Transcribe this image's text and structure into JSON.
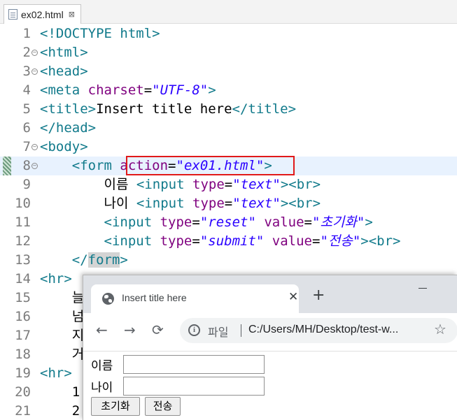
{
  "editor": {
    "tab_label": "ex02.html",
    "tab_close": "⊠",
    "lines": [
      {
        "n": "1"
      },
      {
        "n": "2"
      },
      {
        "n": "3"
      },
      {
        "n": "4"
      },
      {
        "n": "5"
      },
      {
        "n": "6"
      },
      {
        "n": "7"
      },
      {
        "n": "8"
      },
      {
        "n": "9"
      },
      {
        "n": "10"
      },
      {
        "n": "11"
      },
      {
        "n": "12"
      },
      {
        "n": "13"
      },
      {
        "n": "14"
      },
      {
        "n": "15"
      },
      {
        "n": "16"
      },
      {
        "n": "17"
      },
      {
        "n": "18"
      },
      {
        "n": "19"
      },
      {
        "n": "20"
      },
      {
        "n": "21"
      }
    ],
    "code": {
      "l1": "<!DOCTYPE html>",
      "l2": "<html>",
      "l3": "<head>",
      "l4_tag": "<meta ",
      "l4_attr": "charset",
      "l4_val": "\"UTF-8\"",
      "l4_end": ">",
      "l5_open": "<title>",
      "l5_text": "Insert title here",
      "l5_close": "</title>",
      "l6": "</head>",
      "l7": "<body>",
      "l8_tag": "<form ",
      "l8_attr": "action",
      "l8_val": "\"ex01.html\"",
      "l8_end": ">",
      "l9_text": "이름 ",
      "l9_tag": "<input ",
      "l9_attr": "type",
      "l9_val": "\"text\"",
      "l9_end": "><br>",
      "l10_text": "나이 ",
      "l10_tag": "<input ",
      "l10_attr": "type",
      "l10_val": "\"text\"",
      "l10_end": "><br>",
      "l11_tag": "<input ",
      "l11_attr1": "type",
      "l11_val1": "\"reset\"",
      "l11_attr2": "value",
      "l11_val2": "\"초기화\"",
      "l11_end": ">",
      "l12_tag": "<input ",
      "l12_attr1": "type",
      "l12_val1": "\"submit\"",
      "l12_attr2": "value",
      "l12_val2": "\"전송\"",
      "l12_end": "><br>",
      "l13_open": "</",
      "l13_name": "form",
      "l13_end": ">",
      "l14": "<hr>",
      "l15": "늘",
      "l16": "넘",
      "l17": "지",
      "l18": "거",
      "l19": "<hr>",
      "l20": "1",
      "l21": "2"
    }
  },
  "browser": {
    "tab_title": "Insert title here",
    "tab_close": "✕",
    "new_tab": "+",
    "back": "←",
    "forward": "→",
    "reload": "⟳",
    "scheme_label": "파일",
    "url": "C:/Users/MH/Desktop/test-w...",
    "star": "☆",
    "form": {
      "name_label": "이름",
      "age_label": "나이",
      "reset_label": "초기화",
      "submit_label": "전송"
    }
  },
  "icons": {
    "file": "html-file-icon",
    "globe": "globe-icon",
    "info": "info-icon",
    "star": "bookmark-star-icon"
  }
}
